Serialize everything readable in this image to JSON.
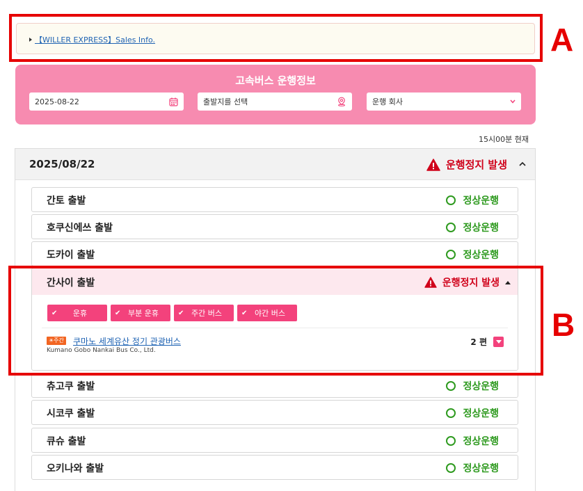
{
  "info": {
    "link_text": "【WILLER EXPRESS】Sales Info."
  },
  "search": {
    "title": "고속버스 운행정보",
    "date_value": "2025-08-22",
    "departure_placeholder": "출발지를 선택",
    "company_placeholder": "운행 회사"
  },
  "current_time": "15시00분 현재",
  "date_section": {
    "date": "2025/08/22",
    "status": "운행정지 발생"
  },
  "rows_top": [
    {
      "label": "간토 출발",
      "status": "정상운행"
    },
    {
      "label": "호쿠신에쓰 출발",
      "status": "정상운행"
    },
    {
      "label": "도카이 출발",
      "status": "정상운행"
    }
  ],
  "expanded": {
    "label": "간사이 출발",
    "status": "운행정지 발생",
    "chips": [
      "운휴",
      "부분 운휴",
      "주간 버스",
      "야간 버스"
    ],
    "route": {
      "badge": "☀주간",
      "name": "쿠마노 세계유산 정기 관광버스",
      "company": "Kumano Gobo Nankai Bus Co., Ltd.",
      "count": "2 편"
    }
  },
  "rows_bottom": [
    {
      "label": "츄고쿠 출발",
      "status": "정상운행"
    },
    {
      "label": "시코쿠 출발",
      "status": "정상운행"
    },
    {
      "label": "큐슈 출발",
      "status": "정상운행"
    },
    {
      "label": "오키나와 출발",
      "status": "정상운행"
    }
  ],
  "annotations": {
    "a": "A",
    "b": "B"
  },
  "colors": {
    "pink": "#f78bb0",
    "accent": "#f3427c",
    "ok_green": "#2e9a1f",
    "alert_red": "#d0021b",
    "annotation_red": "#e60000"
  }
}
